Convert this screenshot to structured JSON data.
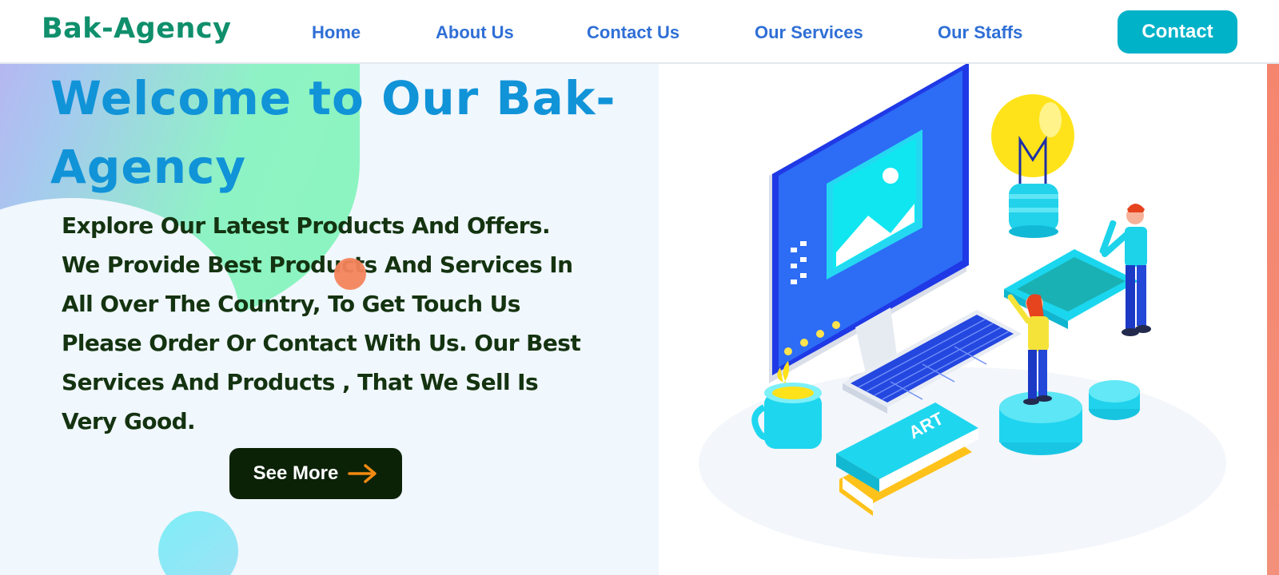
{
  "header": {
    "logo": "Bak-Agency",
    "nav": {
      "home": "Home",
      "about": "About Us",
      "contact": "Contact Us",
      "services": "Our Services",
      "staffs": "Our Staffs"
    },
    "contact_button": "Contact"
  },
  "hero": {
    "title": "Welcome to Our Bak-Agency",
    "description": "Explore Our Latest Products And Offers. We Provide Best Products And Services In All Over The Country, To Get Touch Us Please Order Or Contact With Us. Our Best Services And Products , That We Sell Is Very Good.",
    "see_more_label": "See More",
    "arrow_icon": "arrow-right-icon"
  },
  "illustration": {
    "book_text": "ART",
    "icons": [
      "monitor-icon",
      "lightbulb-icon",
      "keyboard-icon",
      "tablet-icon",
      "mug-icon",
      "books-icon",
      "person-icon"
    ]
  },
  "colors": {
    "logo": "#0f8f6c",
    "nav": "#2f6fd6",
    "contact_button": "#00b2c8",
    "title": "#1193d8",
    "description": "#143310",
    "see_more_bg": "#0b2207",
    "arrow": "#f28a12"
  }
}
